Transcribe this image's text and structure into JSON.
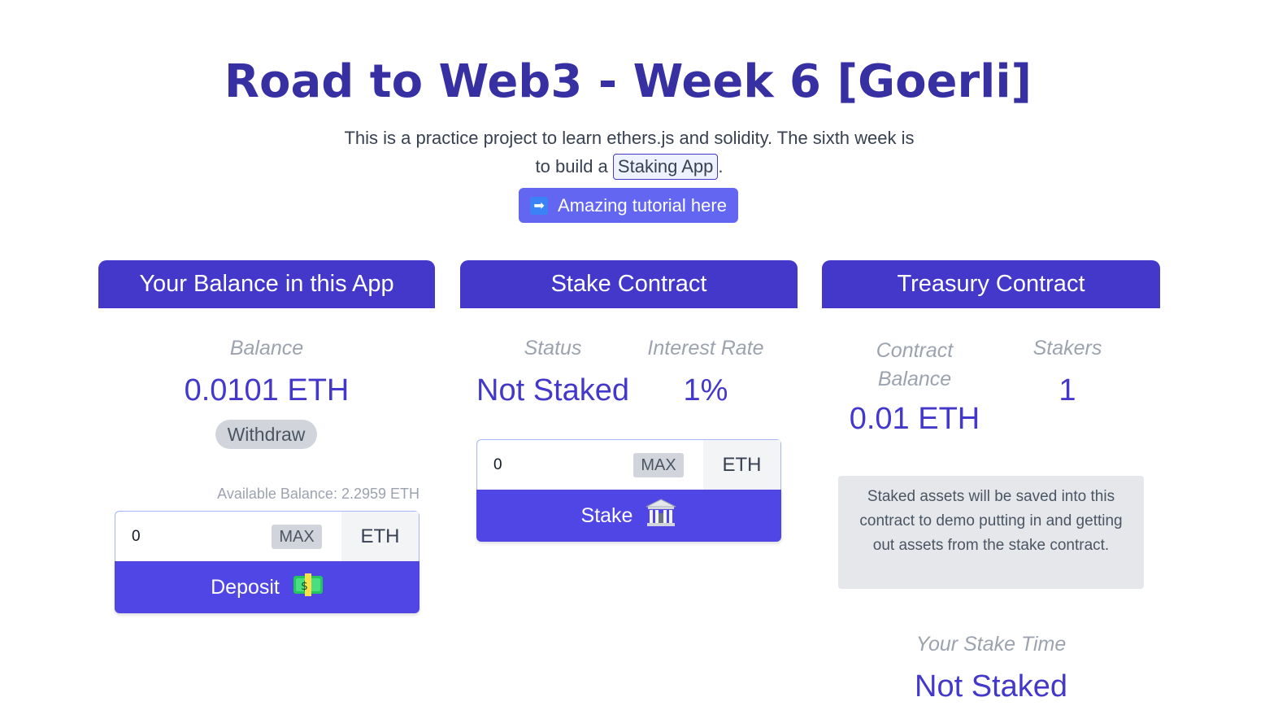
{
  "header": {
    "title": "Road to Web3 - Week 6 [Goerli]",
    "description_prefix": "This is a practice project to learn ethers.js and solidity. The sixth week is to build a",
    "code_chip": "Staking App",
    "description_suffix": ".",
    "tutorial_button": "Amazing tutorial here",
    "tutorial_icon": "right-arrow-icon"
  },
  "balance_card": {
    "title": "Your Balance in this App",
    "balance_label": "Balance",
    "balance_value": "0.0101 ETH",
    "withdraw_label": "Withdraw",
    "available_balance": "Available Balance: 2.2959 ETH",
    "input_value": "0",
    "max_label": "MAX",
    "unit": "ETH",
    "deposit_label": "Deposit",
    "deposit_icon": "money-icon"
  },
  "stake_card": {
    "title": "Stake Contract",
    "status_label": "Status",
    "status_value": "Not Staked",
    "rate_label": "Interest Rate",
    "rate_value": "1%",
    "input_value": "0",
    "max_label": "MAX",
    "unit": "ETH",
    "stake_label": "Stake",
    "stake_icon": "bank-icon"
  },
  "treasury_card": {
    "title": "Treasury Contract",
    "balance_label_line1": "Contract",
    "balance_label_line2": "Balance",
    "balance_value": "0.01 ETH",
    "stakers_label": "Stakers",
    "stakers_value": "1",
    "note": "Staked assets will be saved into this contract to demo putting in and getting out assets from the stake contract.",
    "stake_time_label": "Your Stake Time",
    "stake_time_value": "Not Staked"
  },
  "colors": {
    "primary": "#4338ca",
    "button": "#4f46e5",
    "tutorial": "#6366f1"
  }
}
